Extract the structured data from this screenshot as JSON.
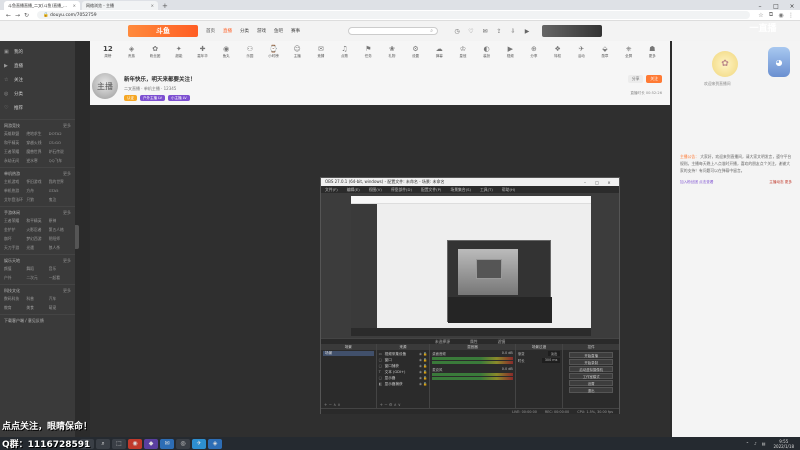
{
  "browser": {
    "tabs": [
      {
        "title": "斗鱼直播直播_二叉(斗鱼)直播_...",
        "active": true
      },
      {
        "title": "网络浏览 - 主播",
        "active": false
      }
    ],
    "url": "douyu.com/7052759"
  },
  "site": {
    "logo": "斗鱼",
    "nav": [
      "首页",
      "直播",
      "分类",
      "游戏",
      "鱼吧",
      "赛事"
    ],
    "nav_active": 1,
    "corner_badge": "一直播"
  },
  "sidebar": {
    "main": [
      {
        "icon": "▣",
        "label": "我的"
      },
      {
        "icon": "▶",
        "label": "直播"
      },
      {
        "icon": "☆",
        "label": "关注"
      },
      {
        "icon": "◎",
        "label": "分类"
      },
      {
        "icon": "♡",
        "label": "推荐"
      }
    ],
    "groups": [
      {
        "title": "网游竞技",
        "more": "更多",
        "items": [
          "英雄联盟",
          "绝地求生",
          "DOTA2",
          "和平精英",
          "穿越火线",
          "CS:GO",
          "王者荣耀",
          "魔兽世界",
          "炉石传说",
          "永劫无间",
          "逆水寒",
          "QQ飞车"
        ]
      },
      {
        "title": "单机热游",
        "more": "更多",
        "items": [
          "主机游戏",
          "怀旧游戏",
          "我的世界",
          "单机热游",
          "方舟",
          "GTA5",
          "艾尔登法环",
          "只狼",
          "鬼泣"
        ]
      },
      {
        "title": "手游休闲",
        "more": "更多",
        "items": [
          "王者荣耀",
          "和平精英",
          "原神",
          "金铲铲",
          "火影忍者",
          "第五人格",
          "崩坏",
          "梦幻西游",
          "阴阳师",
          "天刀手游",
          "光遇",
          "狼人杀"
        ]
      },
      {
        "title": "娱乐天地",
        "more": "更多",
        "items": [
          "颜值",
          "舞蹈",
          "音乐",
          "户外",
          "二次元",
          "一起看"
        ]
      },
      {
        "title": "科技文化",
        "more": "更多",
        "items": [
          "数码科技",
          "科普",
          "汽车",
          "教育",
          "美食",
          "萌宠"
        ]
      }
    ],
    "footer": "下载客户端 / 意见反馈"
  },
  "room": {
    "categories": [
      {
        "icon": "12",
        "label": "周榜"
      },
      {
        "icon": "◈",
        "label": "贵族"
      },
      {
        "icon": "✿",
        "label": "粉丝团"
      },
      {
        "icon": "✦",
        "label": "超能"
      },
      {
        "icon": "✚",
        "label": "嘉年华"
      },
      {
        "icon": "◉",
        "label": "鱼丸"
      },
      {
        "icon": "⚇",
        "label": "乐园"
      },
      {
        "icon": "⌚",
        "label": "小时榜"
      },
      {
        "icon": "☺",
        "label": "主播"
      },
      {
        "icon": "✉",
        "label": "竞猜"
      },
      {
        "icon": "♫",
        "label": "点歌"
      },
      {
        "icon": "⚑",
        "label": "任务"
      },
      {
        "icon": "❀",
        "label": "礼物"
      },
      {
        "icon": "⚙",
        "label": "设置"
      },
      {
        "icon": "☁",
        "label": "弹幕"
      },
      {
        "icon": "♔",
        "label": "皇冠"
      },
      {
        "icon": "◐",
        "label": "装扮"
      },
      {
        "icon": "▶",
        "label": "视频"
      },
      {
        "icon": "⊕",
        "label": "分享"
      },
      {
        "icon": "❖",
        "label": "特权"
      },
      {
        "icon": "✈",
        "label": "活动"
      },
      {
        "icon": "⬙",
        "label": "勋章"
      },
      {
        "icon": "⎈",
        "label": "全屏"
      },
      {
        "icon": "☗",
        "label": "更多"
      }
    ],
    "avatar_text": "主播",
    "title": "新年快乐，明天来都要关注！",
    "subtitle": "二叉直播  ·  单机主播  ·  12345",
    "tags": [
      "认证",
      "户外主播 LV",
      "小主播 LV"
    ],
    "buttons": [
      "分享",
      "关注"
    ],
    "meta": "直播时长 00:52:26"
  },
  "obs": {
    "title": "OBS 27.0.1 (64-bit, windows) - 配置文件: 未命名 - 场景: 未命名",
    "menu": [
      "文件(F)",
      "编辑(E)",
      "视图(V)",
      "停靠部件(D)",
      "配置文件(P)",
      "场景集合(S)",
      "工具(T)",
      "帮助(H)"
    ],
    "status_top": [
      "未选择源",
      "属性",
      "滤镜"
    ],
    "docks": {
      "scenes": {
        "header": "场景",
        "items": [
          "场景"
        ]
      },
      "sources": {
        "header": "来源",
        "items": [
          {
            "icon": "▭",
            "name": "视频采集设备"
          },
          {
            "icon": "▢",
            "name": "窗口"
          },
          {
            "icon": "▢",
            "name": "窗口捕获"
          },
          {
            "icon": "T",
            "name": "文本 (GDI+)"
          },
          {
            "icon": "▢",
            "name": "显示器"
          },
          {
            "icon": "◧",
            "name": "显示器捕获"
          }
        ]
      },
      "mixer": {
        "header": "混音器",
        "tracks": [
          {
            "name": "桌面音频",
            "db": "0.0 dB"
          },
          {
            "name": "麦克风",
            "db": "0.0 dB"
          }
        ]
      },
      "transitions": {
        "header": "场景过渡",
        "rows": [
          {
            "label": "渐变",
            "value": "淡出"
          },
          {
            "label": "时长",
            "value": "300 ms"
          }
        ]
      },
      "controls": {
        "header": "控件",
        "items": [
          "开始直播",
          "开始录制",
          "启动虚拟摄像机",
          "工作室模式",
          "设置",
          "退出"
        ]
      }
    },
    "status_bottom": [
      "LIVE: 00:00:00",
      "REC: 00:00:00",
      "CPU: 1.5%, 30.00 fps"
    ]
  },
  "right_panel": {
    "gift1_label": "欢迎来到直播间",
    "notice_label": "主播公告：",
    "notice": "大家好，欢迎来到直播间，请大家文明发言，遵守平台规则。主播每天晚上八点准时开播，喜欢的朋友点个关注，谢谢大家的支持！有问题可以在弹幕中留言。",
    "links": [
      "加入粉丝团 点击查看",
      "主播动态 更多"
    ]
  },
  "overlay": {
    "line1": "点点关注，眼睛保命！",
    "line2": "Q群：1116728591"
  },
  "taskbar": {
    "apps": [
      "⊞",
      "⌕",
      "⬚",
      "◉",
      "◆",
      "✉",
      "◎",
      "✈",
      "◈"
    ],
    "tray_symbols": [
      "⌃",
      "♪",
      "▤"
    ],
    "time": "9:55",
    "date": "2022/1/18"
  }
}
